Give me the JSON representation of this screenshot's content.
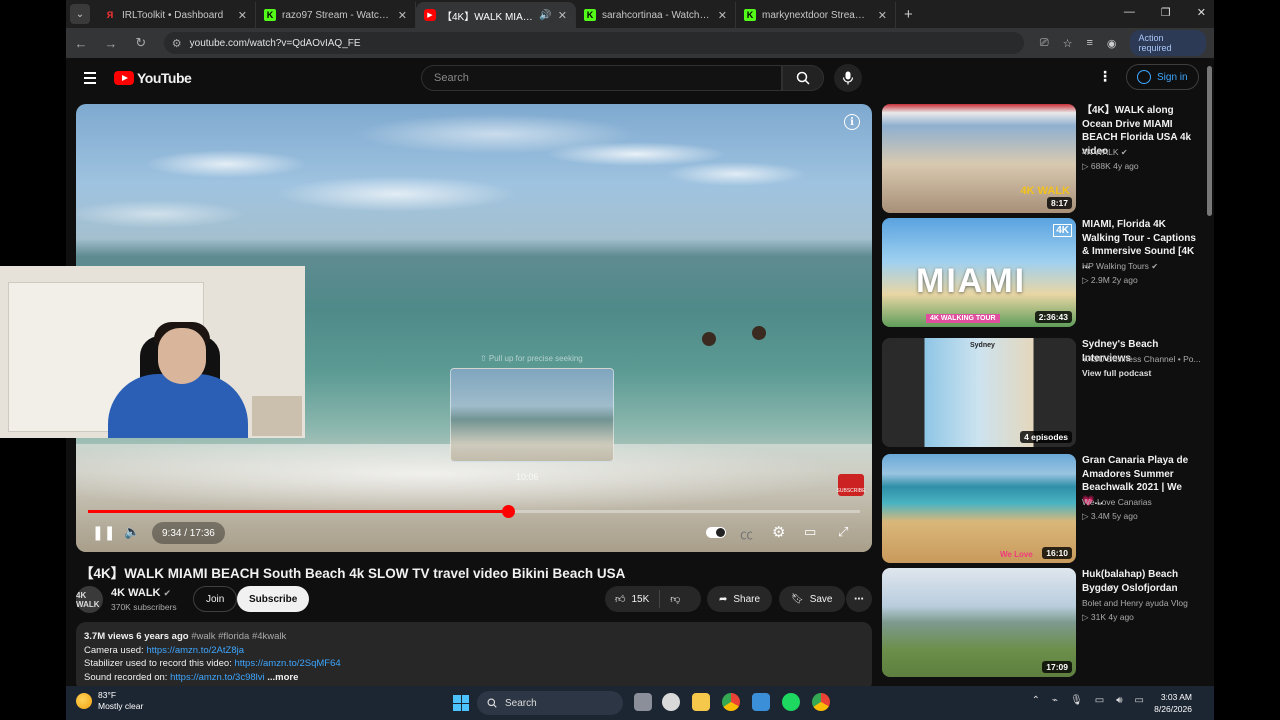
{
  "browser": {
    "tabs": [
      {
        "favicon": "ya",
        "title": "IRLToolkit • Dashboard",
        "active": false
      },
      {
        "favicon": "kick",
        "title": "razo97 Stream - Watch Live on",
        "active": false
      },
      {
        "favicon": "yt",
        "title": "【4K】WALK MIAMI BEACH S",
        "active": true
      },
      {
        "favicon": "kick",
        "title": "sarahcortinaa - Watch clips on",
        "active": false
      },
      {
        "favicon": "kick",
        "title": "markynextdoor Stream - Watch",
        "active": false
      }
    ],
    "url": "youtube.com/watch?v=QdAOvIAQ_FE",
    "action_required": "Action required"
  },
  "youtube": {
    "logo_text": "YouTube",
    "search_placeholder": "Search",
    "sign_in": "Sign in"
  },
  "player": {
    "current_time": "9:34",
    "duration": "17:36",
    "time_display": "9:34 / 17:36",
    "progress_fraction": 0.544,
    "preview_time": "10:06",
    "preview_hint": "⇧ Pull up for precise seeking",
    "watermark": "SUBSCRIBE"
  },
  "video": {
    "title": "【4K】WALK MIAMI BEACH South Beach 4k SLOW TV travel video Bikini Beach USA",
    "channel": "4K WALK",
    "channel_avatar_text": "4K WALK",
    "subscribers": "370K subscribers",
    "join_label": "Join",
    "subscribe_label": "Subscribe",
    "likes": "15K",
    "share_label": "Share",
    "save_label": "Save"
  },
  "description": {
    "views": "3.7M views",
    "age": "6 years ago",
    "tags": "#walk #florida #4kwalk",
    "lines": [
      {
        "label": "Camera used: ",
        "link": "https://amzn.to/2AtZ8ja"
      },
      {
        "label": "Stabilizer used to record this video: ",
        "link": "https://amzn.to/2SqMF64"
      },
      {
        "label": "Sound recorded on: ",
        "link": "https://amzn.to/3c98lvi"
      }
    ],
    "more": "...more"
  },
  "sidebar": [
    {
      "title": "【4K】WALK along Ocean Drive MIAMI BEACH Florida USA 4k video",
      "channel": "4K WALK",
      "verified": true,
      "meta": "▷ 688K  4y ago",
      "duration": "8:17",
      "thumb_label": "4K WALK"
    },
    {
      "title": "MIAMI, Florida 4K Walking Tour - Captions & Immersive Sound [4K ...",
      "channel": "HP Walking Tours",
      "verified": true,
      "meta": "▷ 2.9M  2y ago",
      "duration": "2:36:43",
      "thumb_label": "MIAMI",
      "thumb_sub": "4K WALKING TOUR",
      "badge": "4K"
    },
    {
      "title": "Sydney's Beach Interviews",
      "channel": "YASU Business Channel • Po...",
      "verified": false,
      "meta": "View full podcast",
      "duration": "4 episodes",
      "thumb_label": "Sydney"
    },
    {
      "title": "Gran Canaria Playa de Amadores Summer Beachwalk 2021 | We 💗...",
      "channel": "We Love Canarias",
      "verified": false,
      "meta": "▷ 3.4M  5y ago",
      "duration": "16:10",
      "thumb_label": "We Love"
    },
    {
      "title": "Huk(balahap) Beach Bygdøy Oslofjordan",
      "channel": "Bolet and Henry ayuda Vlog",
      "verified": false,
      "meta": "▷ 31K  4y ago",
      "duration": "17:09"
    }
  ],
  "taskbar": {
    "temp": "83°F",
    "weather": "Mostly clear",
    "search": "Search",
    "time": "3:03 AM",
    "date": "8/26/2026"
  },
  "colors": {
    "accent_red": "#ff0000",
    "link_blue": "#3ea6ff",
    "page_bg": "#0f0f0f"
  }
}
